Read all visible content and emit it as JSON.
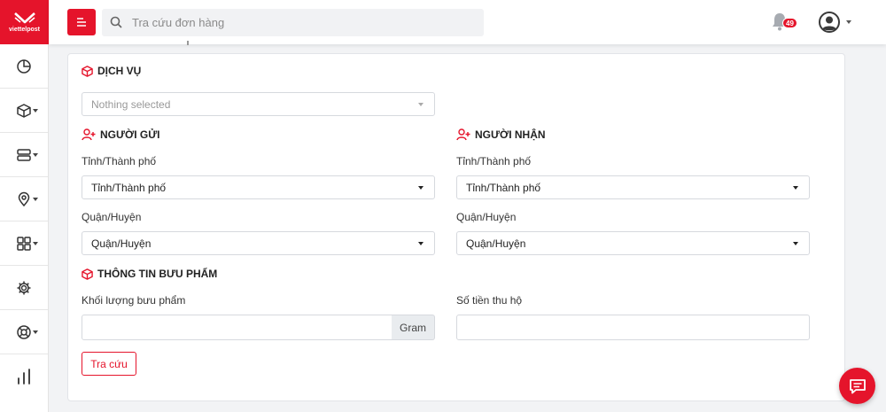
{
  "brand": {
    "logo_text": "viettelpost",
    "accent": "#e5142b"
  },
  "sidebar": {
    "items": [
      {
        "icon": "chart-pie-icon",
        "has_caret": false
      },
      {
        "icon": "package-icon",
        "has_caret": true
      },
      {
        "icon": "server-icon",
        "has_caret": true
      },
      {
        "icon": "location-pin-icon",
        "has_caret": true
      },
      {
        "icon": "grid-icon",
        "has_caret": true
      },
      {
        "icon": "gear-icon",
        "has_caret": false
      },
      {
        "icon": "lifebuoy-icon",
        "has_caret": true
      },
      {
        "icon": "bar-chart-icon",
        "has_caret": false
      }
    ]
  },
  "topbar": {
    "search_placeholder": "Tra cứu đơn hàng",
    "notification_count": "49"
  },
  "form": {
    "service": {
      "title": "DỊCH VỤ",
      "placeholder": "Nothing selected"
    },
    "sender": {
      "title": "NGƯỜI GỬI",
      "province_label": "Tỉnh/Thành phố",
      "province_value": "Tỉnh/Thành phố",
      "district_label": "Quận/Huyện",
      "district_value": "Quận/Huyện"
    },
    "receiver": {
      "title": "NGƯỜI NHẬN",
      "province_label": "Tỉnh/Thành phố",
      "province_value": "Tỉnh/Thành phố",
      "district_label": "Quận/Huyện",
      "district_value": "Quận/Huyện"
    },
    "parcel": {
      "title": "THÔNG TIN BƯU PHẨM",
      "weight_label": "Khối lượng bưu phẩm",
      "weight_unit": "Gram",
      "cod_label": "Số tiền thu hộ"
    },
    "submit_label": "Tra cứu"
  }
}
